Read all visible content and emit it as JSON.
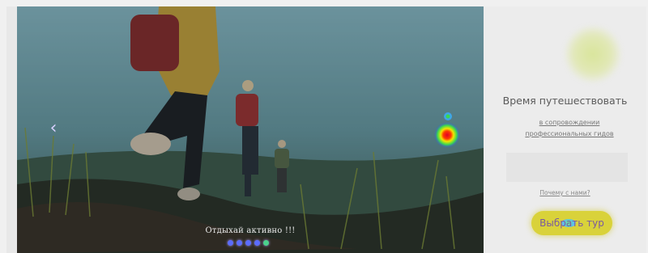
{
  "slider": {
    "prev_icon": "chevron-left-icon",
    "caption": "Отдыхай активно !!!",
    "dots": [
      {
        "active": false
      },
      {
        "active": false
      },
      {
        "active": false
      },
      {
        "active": false
      },
      {
        "active": true
      }
    ]
  },
  "panel": {
    "title": "Время путешествовать",
    "subtitle_line1": "в сопровождении",
    "subtitle_line2": "профессиональных гидов",
    "link": "Почему с нами?",
    "cta_label": "Выбрать тур"
  },
  "colors": {
    "cta_bg": "#d9d23a",
    "cta_text": "#7a5aa0",
    "dot": "#5b6cff",
    "dot_active": "#4bd38b"
  }
}
